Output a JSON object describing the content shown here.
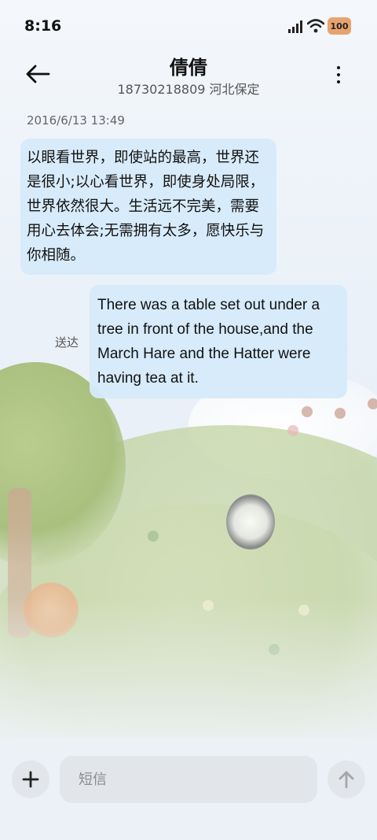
{
  "status_bar": {
    "time": "8:16",
    "battery": "100",
    "battery_color": "#e7a36e"
  },
  "header": {
    "contact_name": "倩倩",
    "contact_sub": "18730218809 河北保定",
    "back_icon": "arrow-left-icon",
    "more_icon": "more-vertical-icon"
  },
  "conversation": {
    "timestamp": "2016/6/13 13:49",
    "messages": [
      {
        "direction": "incoming",
        "text": "以眼看世界，即使站的最高，世界还是很小;以心看世界，即使身处局限，世界依然很大。生活远不完美，需要用心去体会;无需拥有太多，愿快乐与你相随。"
      },
      {
        "direction": "outgoing",
        "status": "送达",
        "text": "There was a table set out under a tree in front of the house,and the March Hare and the Hatter were having tea at it."
      }
    ]
  },
  "composer": {
    "placeholder": "短信",
    "add_icon": "plus-icon",
    "send_icon": "arrow-up-icon"
  },
  "theme": {
    "bubble_color": "#d6eafa",
    "accent": "#111111"
  }
}
